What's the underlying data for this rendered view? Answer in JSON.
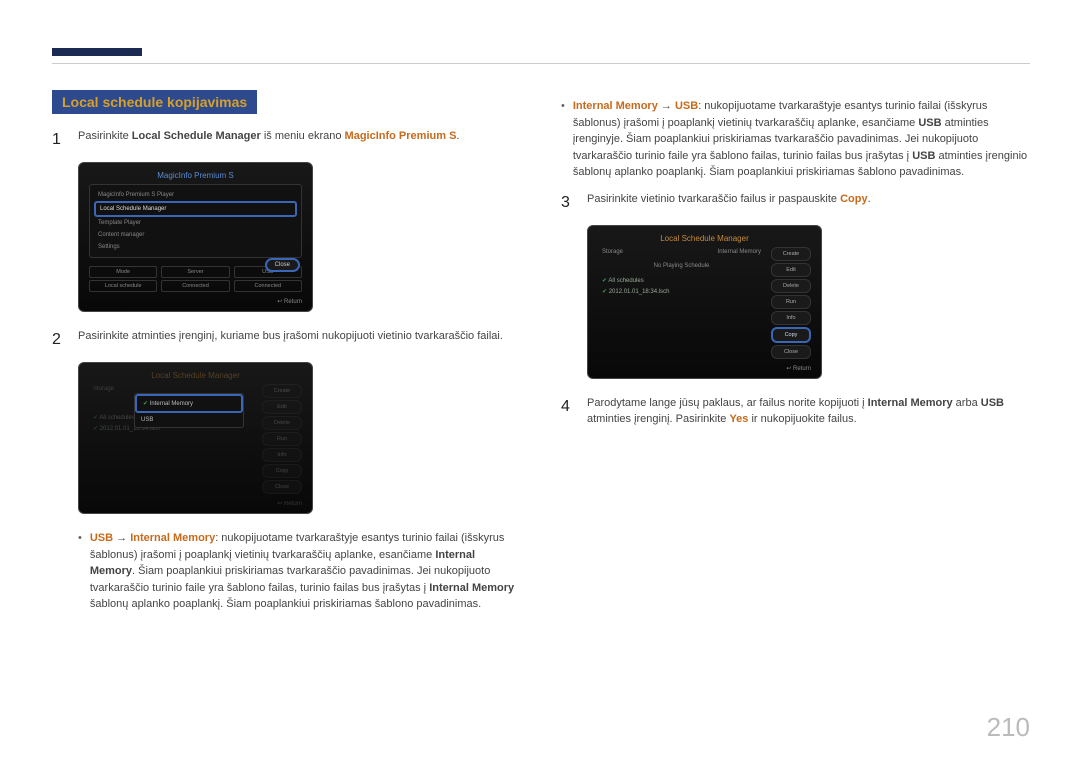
{
  "page_number": "210",
  "section_title": "Local schedule kopijavimas",
  "left": {
    "step1": {
      "pre": "Pasirinkite ",
      "b1": "Local Schedule Manager",
      "mid": " iš meniu ekrano ",
      "b2": "MagicInfo Premium S",
      "post": "."
    },
    "panel1": {
      "title": "MagicInfo Premium S",
      "items": [
        "MagicInfo Premium S Player",
        "Local Schedule Manager",
        "Template Player",
        "Content manager",
        "Settings"
      ],
      "close": "Close",
      "status_head": [
        "Mode",
        "Server",
        "USB"
      ],
      "status_val": [
        "Local schedule",
        "Connected",
        "Connected"
      ],
      "return": "Return"
    },
    "step2": "Pasirinkite atminties įrenginį, kuriame bus įrašomi nukopijuoti vietinio tvarkaraščio failai.",
    "panel2": {
      "title": "Local Schedule Manager",
      "storage_label": "Storage",
      "noplay": "No …",
      "chk1": "All schedules",
      "chk2": "2012.01.01_18:34.lsch",
      "dd": [
        "Internal Memory",
        "USB"
      ],
      "btns": [
        "Create",
        "Edit",
        "Delete",
        "Run",
        "Info",
        "Copy",
        "Close"
      ],
      "return": "Return"
    },
    "bullet_usb": {
      "b1": "USB",
      "arrow": " → ",
      "b2": "Internal Memory",
      "text1": ": nukopijuotame tvarkaraštyje esantys turinio failai (išskyrus šablonus) įrašomi į poaplankį vietinių tvarkaraščių aplanke, esančiame ",
      "b3": "Internal Memory",
      "text2": ". Šiam poaplankiui priskiriamas tvarkaraščio pavadinimas. Jei nukopijuoto tvarkaraščio turinio faile yra šablono failas, turinio failas bus įrašytas į ",
      "b4": "Internal Memory",
      "text3": " šablonų aplanko poaplankį. Šiam poaplankiui priskiriamas šablono pavadinimas."
    }
  },
  "right": {
    "bullet_im": {
      "b1": "Internal Memory",
      "arrow": " → ",
      "b2": "USB",
      "text1": ": nukopijuotame tvarkaraštyje esantys turinio failai (išskyrus šablonus) įrašomi į poaplankį vietinių tvarkaraščių aplanke, esančiame ",
      "b3": "USB",
      "text2": " atminties įrenginyje. Šiam poaplankiui priskiriamas tvarkaraščio pavadinimas. Jei nukopijuoto tvarkaraščio turinio faile yra šablono failas, turinio failas bus įrašytas į ",
      "b4": "USB",
      "text3": " atminties įrenginio šablonų aplanko poaplankį. Šiam poaplankiui priskiriamas šablono pavadinimas."
    },
    "step3": {
      "pre": "Pasirinkite vietinio tvarkaraščio failus ir paspauskite ",
      "b1": "Copy",
      "post": "."
    },
    "panel3": {
      "title": "Local Schedule Manager",
      "storage_label": "Storage",
      "storage_val": "Internal Memory",
      "noplay": "No Playing Schedule",
      "chk1": "All schedules",
      "chk2": "2012.01.01_18:34.lsch",
      "btns": [
        "Create",
        "Edit",
        "Delete",
        "Run",
        "Info",
        "Copy",
        "Close"
      ],
      "return": "Return"
    },
    "step4": {
      "pre": "Parodytame lange jūsų paklaus, ar failus norite kopijuoti į ",
      "b1": "Internal Memory",
      "mid": " arba ",
      "b2": "USB",
      "post1": " atminties įrenginį. Pasirinkite ",
      "b3": "Yes",
      "post2": " ir nukopijuokite failus."
    }
  }
}
